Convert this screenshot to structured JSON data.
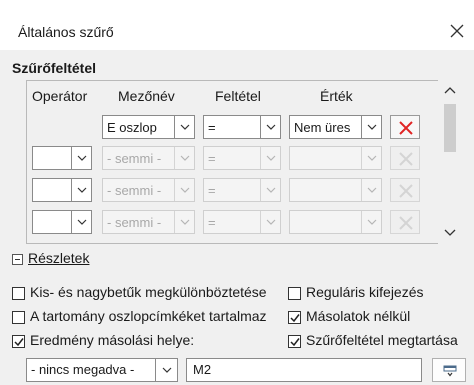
{
  "dialog": {
    "title": "Általános szűrő",
    "close_icon": "close-icon"
  },
  "criteria": {
    "section_title": "Szűrőfeltétel",
    "headers": {
      "operator": "Operátor",
      "field": "Mezőnév",
      "condition": "Feltétel",
      "value": "Érték"
    },
    "rows": [
      {
        "operator": "",
        "field": "E oszlop",
        "condition": "=",
        "value": "Nem üres",
        "enabled": true
      },
      {
        "operator": "",
        "field": "- semmi -",
        "condition": "=",
        "value": "",
        "enabled": false
      },
      {
        "operator": "",
        "field": "- semmi -",
        "condition": "=",
        "value": "",
        "enabled": false
      },
      {
        "operator": "",
        "field": "- semmi -",
        "condition": "=",
        "value": "",
        "enabled": false
      }
    ],
    "delete_icon": "remove-x-icon",
    "delete_color": "#e02424"
  },
  "options": {
    "expander_label": "Részletek",
    "case_sensitive": {
      "label": "Kis- és nagybetűk megkülönböztetése",
      "checked": false
    },
    "regex": {
      "label": "Reguláris kifejezés",
      "checked": false
    },
    "has_headers": {
      "label": "A tartomány oszlopcímkéket tartalmaz",
      "checked": false
    },
    "no_duplicates": {
      "label": "Másolatok nélkül",
      "checked": true
    },
    "copy_results": {
      "label": "Eredmény másolási helye:",
      "checked": true
    },
    "keep_filter": {
      "label": "Szűrőfeltétel megtartása",
      "checked": true
    }
  },
  "output": {
    "named_range": "- nincs megadva -",
    "target": "M2",
    "shrink_icon": "shrink-dialog-icon"
  }
}
